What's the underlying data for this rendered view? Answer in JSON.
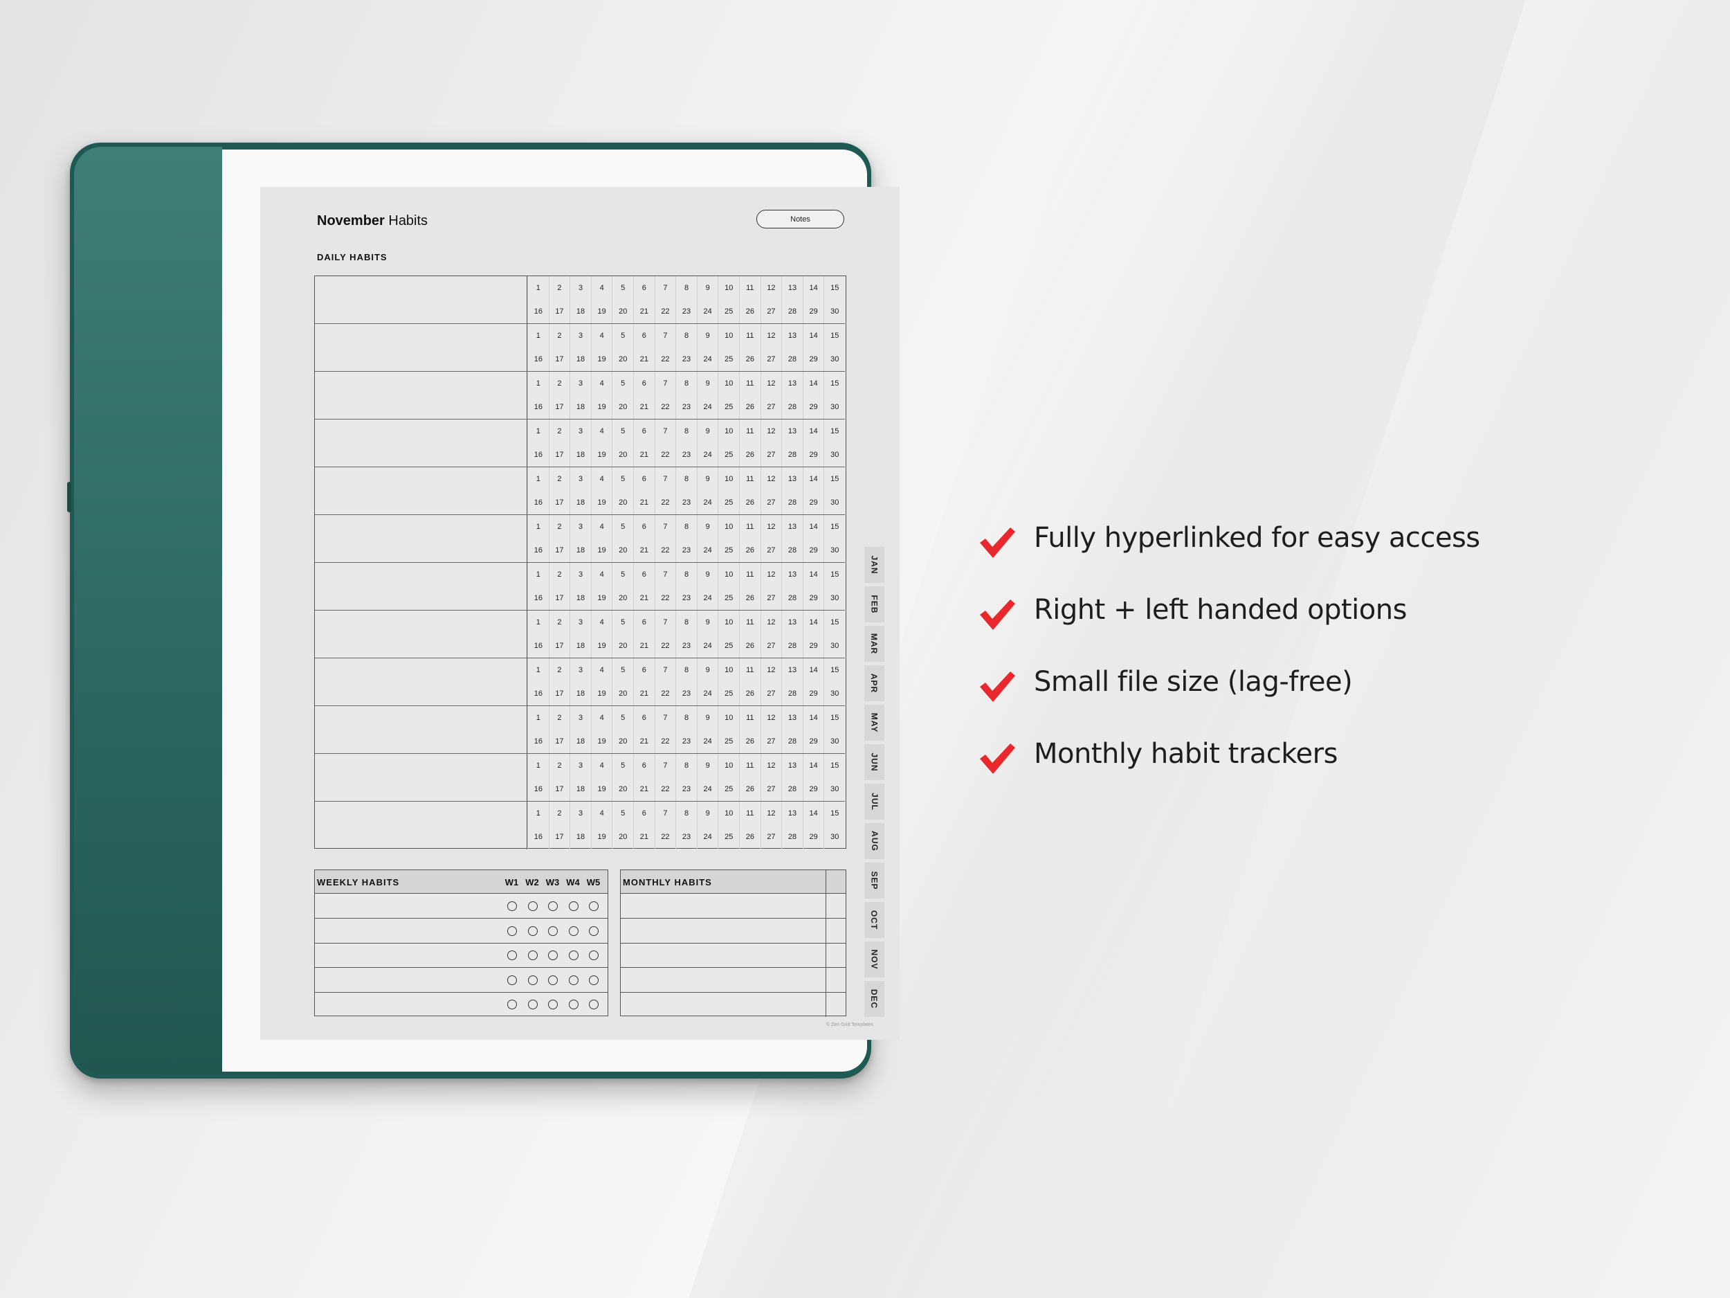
{
  "planner": {
    "title_bold": "November",
    "title_rest": " Habits",
    "notes_button": "Notes",
    "daily_label": "DAILY HABITS",
    "days_first": [
      "1",
      "2",
      "3",
      "4",
      "5",
      "6",
      "7",
      "8",
      "9",
      "10",
      "11",
      "12",
      "13",
      "14",
      "15"
    ],
    "days_second": [
      "16",
      "17",
      "18",
      "19",
      "20",
      "21",
      "22",
      "23",
      "24",
      "25",
      "26",
      "27",
      "28",
      "29",
      "30"
    ],
    "row_count": 12,
    "months": [
      "JAN",
      "FEB",
      "MAR",
      "APR",
      "MAY",
      "JUN",
      "JUL",
      "AUG",
      "SEP",
      "OCT",
      "NOV",
      "DEC"
    ],
    "weekly_label": "WEEKLY HABITS",
    "weeks": [
      "W1",
      "W2",
      "W3",
      "W4",
      "W5"
    ],
    "monthly_label": "MONTHLY HABITS",
    "copyright": "© Zen Grid Templates"
  },
  "features": [
    "Fully hyperlinked for easy access",
    "Right + left handed options",
    "Small file size (lag-free)",
    "Monthly habit trackers"
  ],
  "colors": {
    "device": "#1f5a52",
    "check": "#e8282b",
    "page": "#e6e6e6"
  }
}
